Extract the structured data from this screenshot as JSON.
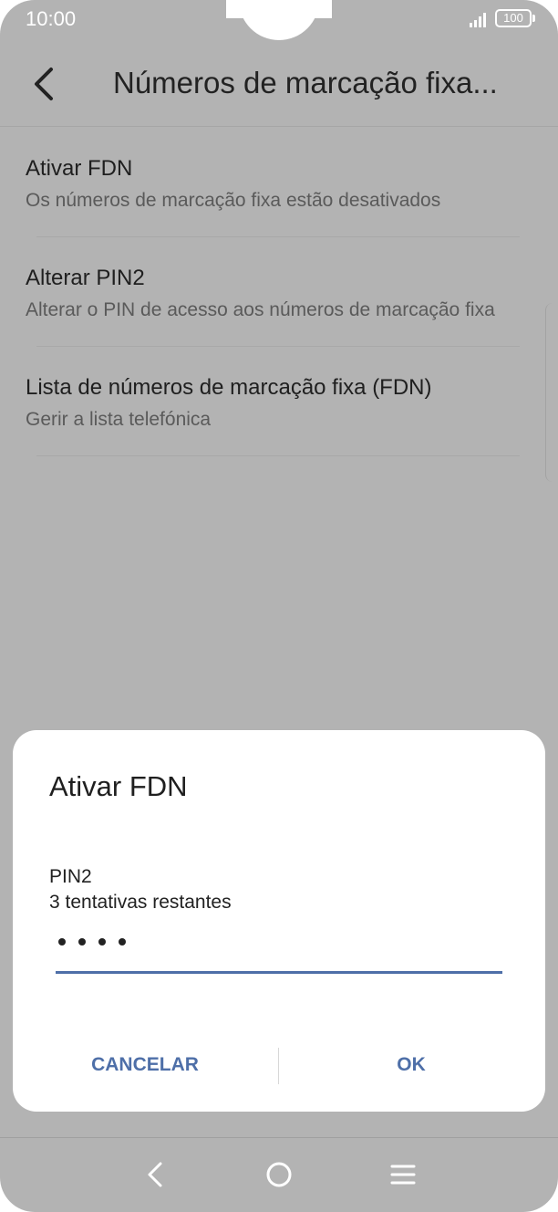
{
  "status_bar": {
    "time": "10:00",
    "battery": "100"
  },
  "app_bar": {
    "title": "Números de marcação fixa..."
  },
  "settings": {
    "items": [
      {
        "title": "Ativar FDN",
        "subtitle": "Os números de marcação fixa estão desativados"
      },
      {
        "title": "Alterar PIN2",
        "subtitle": "Alterar o PIN de acesso aos números de marcação fixa"
      },
      {
        "title": "Lista de números de marcação fixa (FDN)",
        "subtitle": "Gerir a lista telefónica"
      }
    ]
  },
  "dialog": {
    "title": "Ativar FDN",
    "field_label": "PIN2",
    "attempts": "3 tentativas restantes",
    "pin_length": 4,
    "cancel_label": "CANCELAR",
    "ok_label": "OK"
  },
  "colors": {
    "scrim": "#b3b3b3",
    "accent": "#4e6fa8",
    "dialog_bg": "#ffffff"
  },
  "icons": {
    "back": "chevron-left-icon",
    "signal": "signal-bars-icon",
    "battery": "battery-icon",
    "nav_back": "nav-back-icon",
    "nav_home": "nav-home-icon",
    "nav_menu": "nav-menu-icon"
  }
}
